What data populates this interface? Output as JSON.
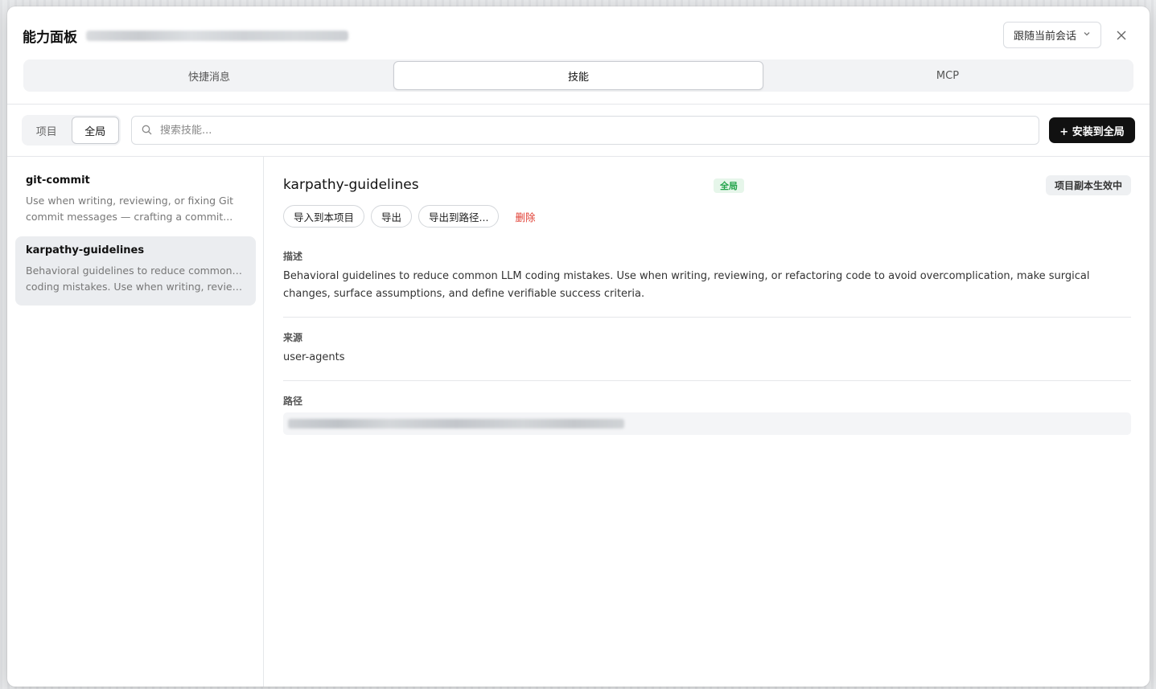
{
  "dialog": {
    "title": "能力面板",
    "session_select": "跟随当前会话",
    "close_icon": "close-icon"
  },
  "tabs": [
    {
      "label": "快捷消息",
      "active": false
    },
    {
      "label": "技能",
      "active": true
    },
    {
      "label": "MCP",
      "active": false
    }
  ],
  "toolbar": {
    "scope": [
      {
        "label": "项目",
        "active": false
      },
      {
        "label": "全局",
        "active": true
      }
    ],
    "search_placeholder": "搜索技能...",
    "install_label": "+ 安装到全局"
  },
  "skills": [
    {
      "name": "git-commit",
      "desc_line1": "Use when writing, reviewing, or fixing Git",
      "desc_line2": "commit messages — crafting a commit...",
      "active": false
    },
    {
      "name": "karpathy-guidelines",
      "desc_line1": "Behavioral guidelines to reduce common LLM",
      "desc_line2": "coding mistakes. Use when writing, reviewing...",
      "active": true
    }
  ],
  "detail": {
    "title": "karpathy-guidelines",
    "badge_scope": "全局",
    "badge_override": "项目副本生效中",
    "actions": {
      "import": "导入到本项目",
      "export": "导出",
      "export_path": "导出到路径...",
      "delete": "删除"
    },
    "description_label": "描述",
    "description": "Behavioral guidelines to reduce common LLM coding mistakes. Use when writing, reviewing, or refactoring code to avoid overcomplication, make surgical changes, surface assumptions, and define verifiable success criteria.",
    "source_label": "来源",
    "source": "user-agents",
    "path_label": "路径"
  },
  "colors": {
    "accent": "#111111",
    "badge_green": "#22a34a",
    "danger": "#e03c31"
  }
}
